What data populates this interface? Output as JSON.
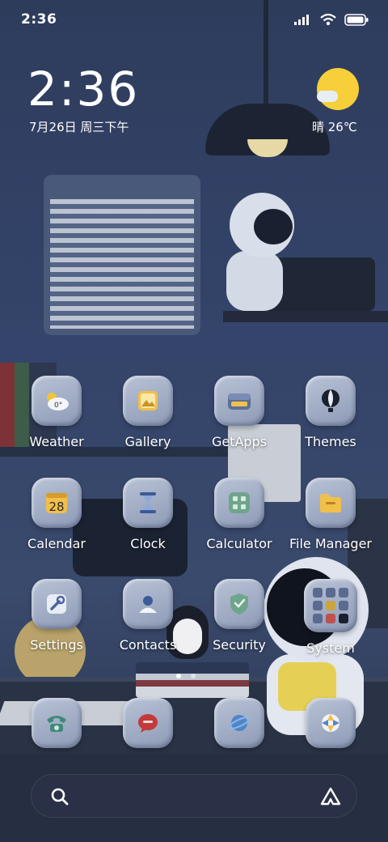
{
  "status_bar": {
    "time": "2:36"
  },
  "clock_widget": {
    "time": "2:36",
    "date": "7月26日 周三下午"
  },
  "weather_widget": {
    "text": "晴 26℃"
  },
  "apps": [
    {
      "label": "Weather",
      "icon": "weather-icon",
      "badge": "0°"
    },
    {
      "label": "Gallery",
      "icon": "gallery-icon"
    },
    {
      "label": "GetApps",
      "icon": "getapps-icon"
    },
    {
      "label": "Themes",
      "icon": "themes-icon"
    },
    {
      "label": "Calendar",
      "icon": "calendar-icon",
      "badge": "28"
    },
    {
      "label": "Clock",
      "icon": "clock-icon"
    },
    {
      "label": "Calculator",
      "icon": "calculator-icon"
    },
    {
      "label": "File Manager",
      "icon": "file-manager-icon"
    },
    {
      "label": "Settings",
      "icon": "settings-icon"
    },
    {
      "label": "Contacts",
      "icon": "contacts-icon"
    },
    {
      "label": "Security",
      "icon": "security-icon"
    },
    {
      "label": "System",
      "icon": "system-folder-icon"
    }
  ],
  "page_indicator": {
    "pages": 2,
    "current": 1
  },
  "dock": [
    {
      "icon": "phone-icon"
    },
    {
      "icon": "messages-icon"
    },
    {
      "icon": "browser-icon"
    },
    {
      "icon": "camera-icon"
    }
  ],
  "colors": {
    "sun": "#f6cf3a",
    "tile": "#a5b0c8",
    "background": "#34446a"
  }
}
